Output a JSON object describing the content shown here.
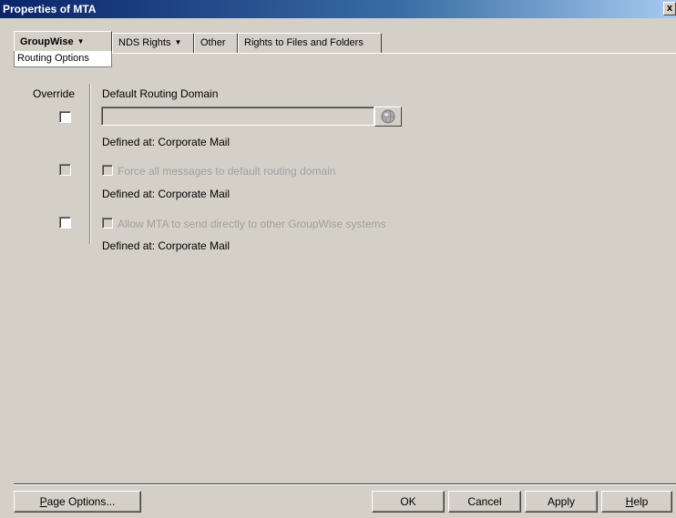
{
  "window": {
    "title": "Properties of MTA",
    "close_glyph": "x"
  },
  "tabs": [
    {
      "label": "GroupWise",
      "has_dropdown": true,
      "active": true
    },
    {
      "label": "NDS Rights",
      "has_dropdown": true,
      "active": false
    },
    {
      "label": "Other",
      "has_dropdown": false,
      "active": false
    },
    {
      "label": "Rights to Files and Folders",
      "has_dropdown": false,
      "active": false
    }
  ],
  "subtab": {
    "label": "Routing Options"
  },
  "form": {
    "override_header": "Override",
    "default_routing_domain": {
      "label": "Default Routing Domain",
      "value": "",
      "defined_at": "Defined at: Corporate Mail",
      "override_checked": false
    },
    "force_all_messages": {
      "label": "Force all messages to default routing domain",
      "checked": false,
      "enabled": false,
      "defined_at": "Defined at: Corporate Mail",
      "override_checked": false,
      "override_enabled": false
    },
    "allow_direct_send": {
      "label": "Allow MTA to send directly to other GroupWise systems",
      "checked": false,
      "enabled": false,
      "defined_at": "Defined at: Corporate Mail",
      "override_checked": false
    }
  },
  "buttons": {
    "page_options": {
      "mnemonic": "P",
      "rest": "age Options..."
    },
    "ok": "OK",
    "cancel": "Cancel",
    "apply": "Apply",
    "help": {
      "mnemonic": "H",
      "rest": "elp"
    }
  },
  "icons": {
    "browse": "globe-browse-icon",
    "dropdown": "caret-down-icon"
  },
  "colors": {
    "titlebar_start": "#0a246a",
    "titlebar_end": "#a6caf0",
    "face": "#d4d0c8",
    "disabled_text": "#a0a0a0"
  }
}
